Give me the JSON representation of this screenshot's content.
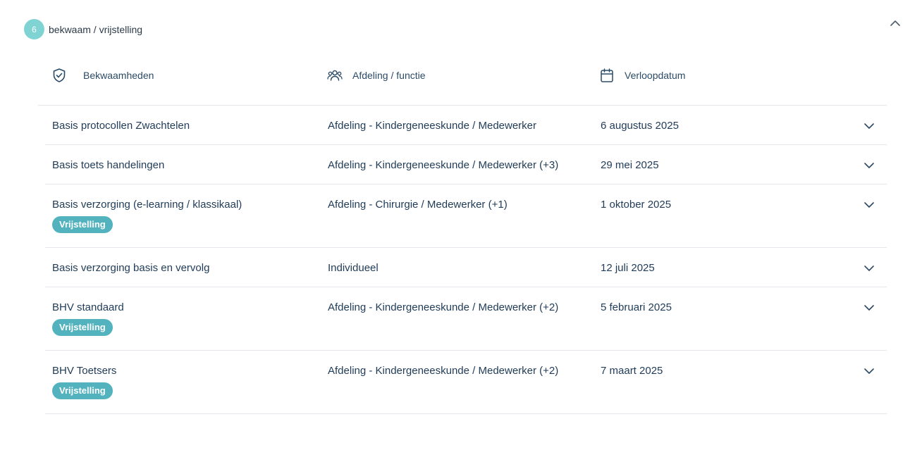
{
  "group": {
    "count": "6",
    "title": "bekwaam / vrijstelling"
  },
  "columns": {
    "skills": "Bekwaamheden",
    "department": "Afdeling / functie",
    "expiry": "Verloopdatum"
  },
  "rows": [
    {
      "name": "Basis protocollen Zwachtelen",
      "department": "Afdeling - Kindergeneeskunde / Medewerker",
      "date": "6 augustus 2025",
      "tag": ""
    },
    {
      "name": "Basis toets handelingen",
      "department": "Afdeling - Kindergeneeskunde / Medewerker (+3)",
      "date": "29 mei 2025",
      "tag": ""
    },
    {
      "name": "Basis verzorging (e-learning / klassikaal)",
      "department": "Afdeling - Chirurgie / Medewerker (+1)",
      "date": "1 oktober 2025",
      "tag": "Vrijstelling"
    },
    {
      "name": "Basis verzorging basis en vervolg",
      "department": "Individueel",
      "date": "12 juli 2025",
      "tag": ""
    },
    {
      "name": "BHV standaard",
      "department": "Afdeling - Kindergeneeskunde / Medewerker (+2)",
      "date": "5 februari 2025",
      "tag": "Vrijstelling"
    },
    {
      "name": "BHV Toetsers",
      "department": "Afdeling - Kindergeneeskunde / Medewerker (+2)",
      "date": "7 maart 2025",
      "tag": "Vrijstelling"
    }
  ],
  "icons": {
    "skills": "shield-check-icon",
    "department": "users-icon",
    "expiry": "calendar-icon",
    "collapse": "chevron-up-icon",
    "expand": "chevron-down-icon"
  },
  "colors": {
    "badge": "#7fd3d3",
    "tag": "#52b3bf",
    "text": "#1f3b57"
  }
}
